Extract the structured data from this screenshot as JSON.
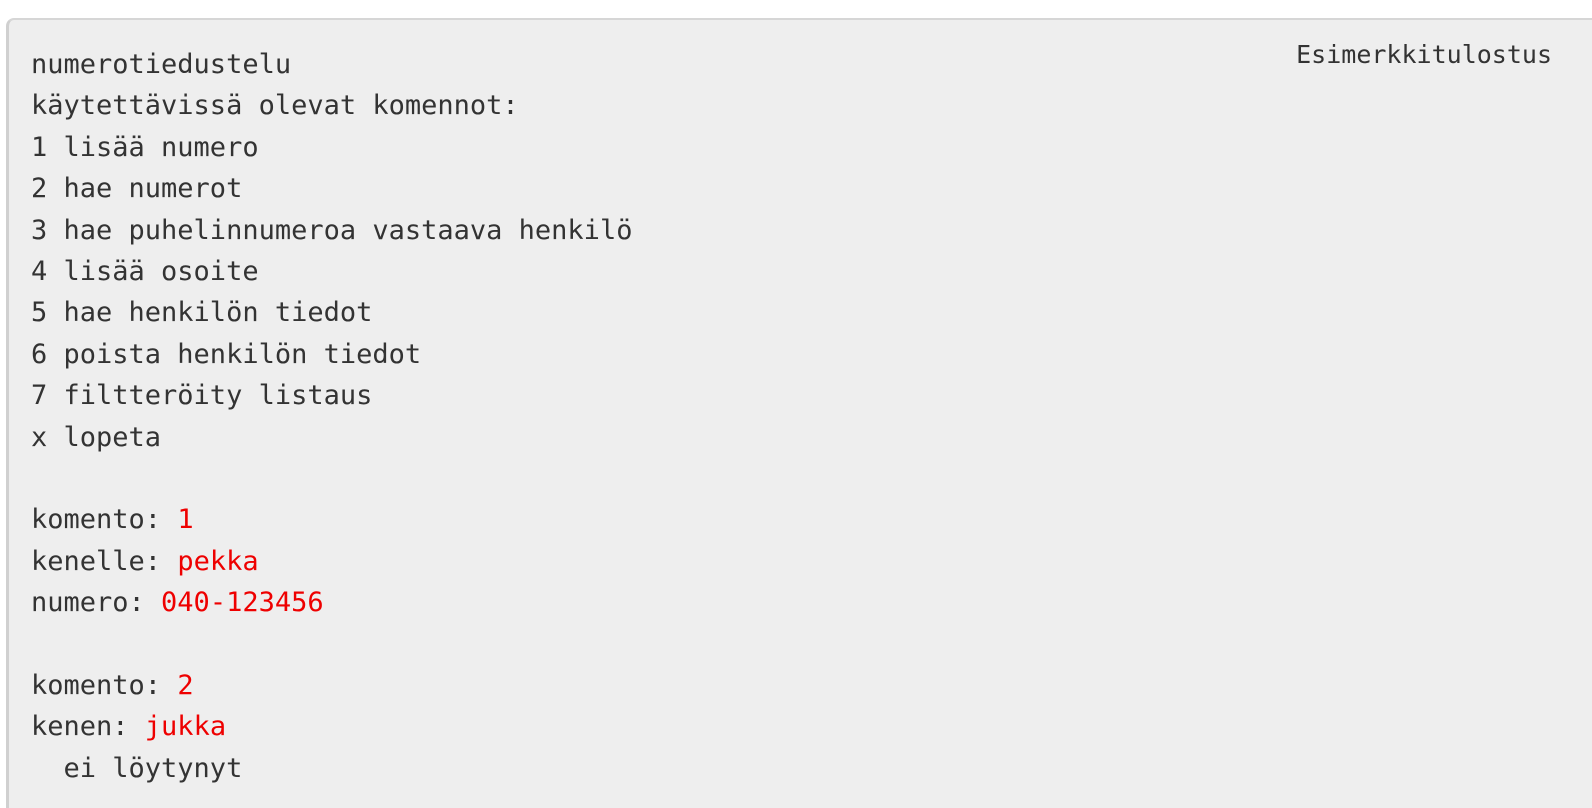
{
  "caption": "Esimerkkitulostus",
  "colors": {
    "background": "#eeeeee",
    "text": "#333333",
    "user_input": "#ee0000"
  },
  "lines": [
    {
      "prompt": "numerotiedustelu",
      "input": ""
    },
    {
      "prompt": "käytettävissä olevat komennot:",
      "input": ""
    },
    {
      "prompt": "1 lisää numero",
      "input": ""
    },
    {
      "prompt": "2 hae numerot",
      "input": ""
    },
    {
      "prompt": "3 hae puhelinnumeroa vastaava henkilö",
      "input": ""
    },
    {
      "prompt": "4 lisää osoite",
      "input": ""
    },
    {
      "prompt": "5 hae henkilön tiedot",
      "input": ""
    },
    {
      "prompt": "6 poista henkilön tiedot",
      "input": ""
    },
    {
      "prompt": "7 filtteröity listaus",
      "input": ""
    },
    {
      "prompt": "x lopeta",
      "input": ""
    },
    {
      "prompt": "",
      "input": ""
    },
    {
      "prompt": "komento: ",
      "input": "1"
    },
    {
      "prompt": "kenelle: ",
      "input": "pekka"
    },
    {
      "prompt": "numero: ",
      "input": "040-123456"
    },
    {
      "prompt": "",
      "input": ""
    },
    {
      "prompt": "komento: ",
      "input": "2"
    },
    {
      "prompt": "kenen: ",
      "input": "jukka"
    },
    {
      "prompt": "  ei löytynyt",
      "input": ""
    }
  ]
}
